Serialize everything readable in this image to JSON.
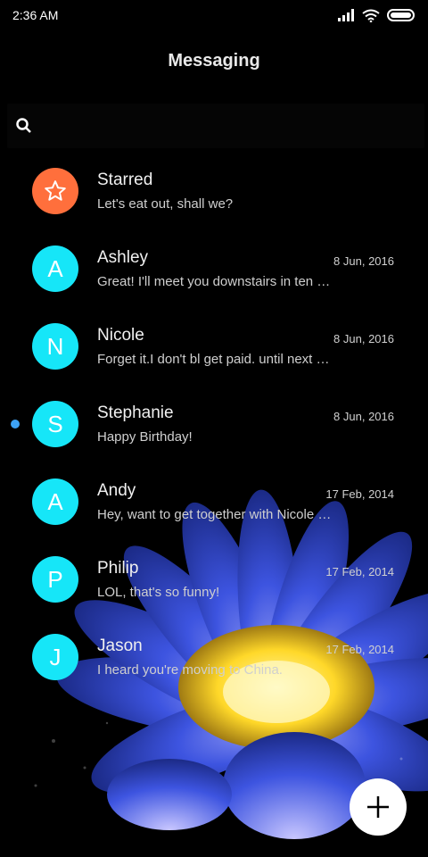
{
  "status": {
    "time": "2:36 AM"
  },
  "header": {
    "title": "Messaging"
  },
  "search": {},
  "conversations": [
    {
      "avatar": "star",
      "name": "Starred",
      "date": "",
      "preview": "Let's eat out, shall we?",
      "unread": false
    },
    {
      "avatar": "A",
      "name": "Ashley",
      "date": "8 Jun, 2016",
      "preview": "Great! I'll meet you downstairs in ten …",
      "unread": false
    },
    {
      "avatar": "N",
      "name": "Nicole",
      "date": "8 Jun, 2016",
      "preview": "Forget it.I don't bl get paid. until next …",
      "unread": false
    },
    {
      "avatar": "S",
      "name": "Stephanie",
      "date": "8 Jun, 2016",
      "preview": "Happy Birthday!",
      "unread": true
    },
    {
      "avatar": "A",
      "name": "Andy",
      "date": "17 Feb, 2014",
      "preview": "Hey, want to get together with Nicole …",
      "unread": false
    },
    {
      "avatar": "P",
      "name": "Philip",
      "date": "17 Feb, 2014",
      "preview": "LOL, that's so funny!",
      "unread": false
    },
    {
      "avatar": "J",
      "name": "Jason",
      "date": "17 Feb, 2014",
      "preview": "I heard you're moving to China.",
      "unread": false
    }
  ],
  "colors": {
    "avatar": "#16e6f8",
    "starred": "#ff6f3c",
    "unread_dot": "#3da2f5"
  }
}
